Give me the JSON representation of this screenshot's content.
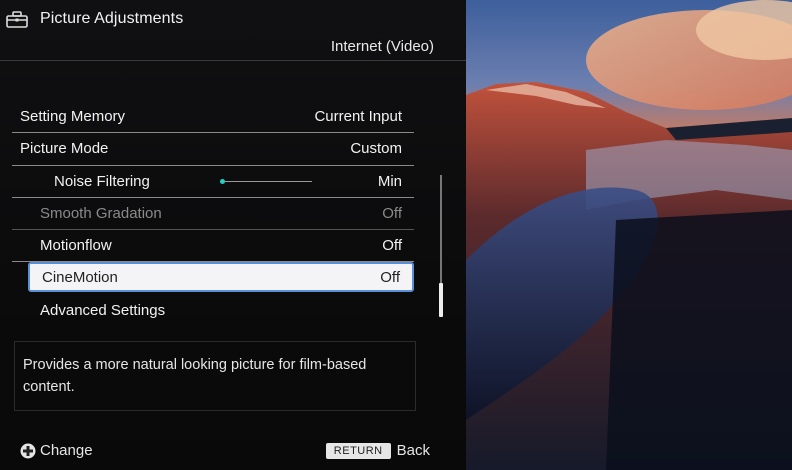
{
  "header": {
    "title": "Picture Adjustments",
    "subtitle": "Internet (Video)",
    "icon": "toolbox-icon"
  },
  "menu": {
    "items": [
      {
        "label": "Setting Memory",
        "value": "Current Input"
      },
      {
        "label": "Picture Mode",
        "value": "Custom"
      },
      {
        "label": "Noise Filtering",
        "value": "Min",
        "slider_level": 0.0
      },
      {
        "label": "Smooth Gradation",
        "value": "Off",
        "disabled": true
      },
      {
        "label": "Motionflow",
        "value": "Off"
      },
      {
        "label": "CineMotion",
        "value": "Off",
        "selected": true
      },
      {
        "label": "Advanced Settings",
        "value": ""
      }
    ]
  },
  "description": "Provides a more natural looking picture for film-based content.",
  "footer": {
    "change_label": "Change",
    "change_icon": "dpad-icon",
    "return_key": "RETURN",
    "back_label": "Back"
  },
  "colors": {
    "selection_border": "#5a8fd6",
    "slider_knob": "#1fd1c4"
  }
}
